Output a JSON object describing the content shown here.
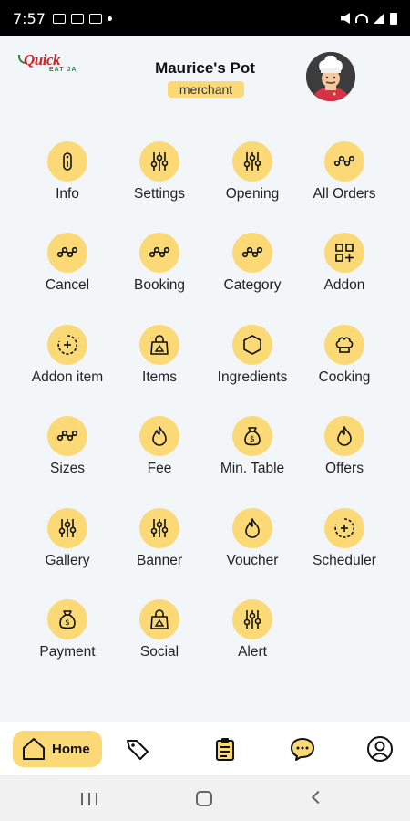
{
  "status_bar": {
    "time": "7:57"
  },
  "header": {
    "logo_primary": "Quick",
    "logo_secondary": "EAT JA",
    "merchant_name": "Maurice's Pot",
    "role": "merchant"
  },
  "menu": [
    {
      "label": "Info",
      "icon": "info-icon"
    },
    {
      "label": "Settings",
      "icon": "sliders-icon"
    },
    {
      "label": "Opening",
      "icon": "sliders-icon"
    },
    {
      "label": "All Orders",
      "icon": "route-icon"
    },
    {
      "label": "Cancel",
      "icon": "route-icon"
    },
    {
      "label": "Booking",
      "icon": "route-icon"
    },
    {
      "label": "Category",
      "icon": "route-icon"
    },
    {
      "label": "Addon",
      "icon": "grid-add-icon"
    },
    {
      "label": "Addon item",
      "icon": "add-circle-icon"
    },
    {
      "label": "Items",
      "icon": "bag-icon"
    },
    {
      "label": "Ingredients",
      "icon": "hexagon-icon"
    },
    {
      "label": "Cooking",
      "icon": "chef-hat-icon"
    },
    {
      "label": "Sizes",
      "icon": "route-icon"
    },
    {
      "label": "Fee",
      "icon": "flame-icon"
    },
    {
      "label": "Min. Table",
      "icon": "money-bag-icon"
    },
    {
      "label": "Offers",
      "icon": "flame-icon"
    },
    {
      "label": "Gallery",
      "icon": "sliders-icon"
    },
    {
      "label": "Banner",
      "icon": "sliders-icon"
    },
    {
      "label": "Voucher",
      "icon": "flame-icon"
    },
    {
      "label": "Scheduler",
      "icon": "add-circle-icon"
    },
    {
      "label": "Payment",
      "icon": "money-bag-icon"
    },
    {
      "label": "Social",
      "icon": "bag-icon"
    },
    {
      "label": "Alert",
      "icon": "sliders-icon"
    }
  ],
  "bottom_nav": {
    "home_label": "Home",
    "items": [
      "home-icon",
      "tag-icon",
      "clipboard-icon",
      "chat-icon",
      "user-icon"
    ]
  },
  "colors": {
    "accent": "#fbd977",
    "background": "#f3f6f9",
    "logo_red": "#d91f26",
    "logo_green": "#2b8a3e"
  }
}
